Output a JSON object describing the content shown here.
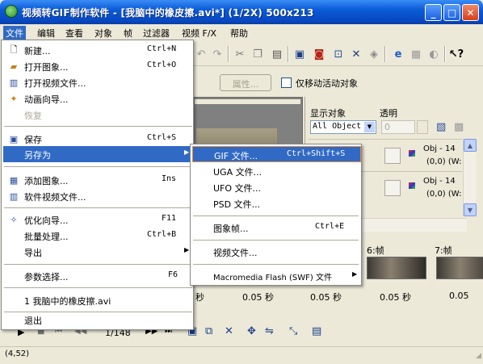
{
  "window": {
    "title": "视频转GIF制作软件  - [我脑中的橡皮擦.avi*] (1/2X)  500x213",
    "minimize": "_",
    "maximize": "□",
    "close": "✕"
  },
  "menubar": [
    "文件",
    "编辑",
    "查看",
    "对象",
    "帧",
    "过滤器",
    "视频 F/X",
    "帮助"
  ],
  "toolbar_icons": [
    "undo-icon",
    "redo-icon",
    "cut-icon",
    "copy-icon",
    "paste-icon",
    "crop-icon",
    "image-icon",
    "resize-icon",
    "crosshair-icon",
    "flip-icon",
    "ie-icon",
    "effects-icon",
    "hat-icon",
    "help-cursor-icon"
  ],
  "properties_button": "属性...",
  "move_active_only": "仅移动活动对象",
  "right_panel": {
    "display_objects_label": "显示对象",
    "transparency_label": "透明",
    "object_select_value": "All Object",
    "transparency_value": "0",
    "objects": [
      {
        "name": "Obj - 14",
        "pos": "(0,0) (W:"
      },
      {
        "name": "Obj - 14",
        "pos": "(0,0) (W:"
      }
    ]
  },
  "frames": {
    "labels": [
      "6:帧",
      "7:帧"
    ],
    "delays": [
      "秒",
      "0.05 秒",
      "0.05 秒",
      "0.05 秒",
      "0.05"
    ]
  },
  "playback": {
    "frame_counter": "1/148"
  },
  "status": {
    "coords": "(4,52)"
  },
  "file_menu": {
    "items": [
      {
        "label": "新建...",
        "shortcut": "Ctrl+N",
        "icon": "new-file-icon"
      },
      {
        "label": "打开图象...",
        "shortcut": "Ctrl+O",
        "icon": "open-image-icon"
      },
      {
        "label": "打开视频文件...",
        "shortcut": "",
        "icon": "open-video-icon"
      },
      {
        "label": "动画向导...",
        "shortcut": "",
        "icon": "wizard-icon"
      },
      {
        "label": "恢复",
        "shortcut": "",
        "icon": "",
        "disabled": true
      },
      {
        "label": "保存",
        "shortcut": "Ctrl+S",
        "icon": "save-icon"
      },
      {
        "label": "另存为",
        "shortcut": "",
        "icon": "",
        "submenu": true
      },
      {
        "label": "添加图象...",
        "shortcut": "Ins",
        "icon": "add-image-icon"
      },
      {
        "label": "软件视频文件...",
        "shortcut": "",
        "icon": "video-file-icon"
      },
      {
        "label": "优化向导...",
        "shortcut": "F11",
        "icon": "optimize-icon"
      },
      {
        "label": "批量处理...",
        "shortcut": "Ctrl+B",
        "icon": ""
      },
      {
        "label": "导出",
        "shortcut": "",
        "icon": "",
        "submenu": true
      },
      {
        "label": "参数选择...",
        "shortcut": "F6",
        "icon": ""
      },
      {
        "label": "1 我脑中的橡皮擦.avi",
        "shortcut": "",
        "icon": ""
      },
      {
        "label": "退出",
        "shortcut": "",
        "icon": ""
      }
    ]
  },
  "saveas_menu": {
    "items": [
      {
        "label": "GIF 文件...",
        "shortcut": "Ctrl+Shift+S"
      },
      {
        "label": "UGA 文件...",
        "shortcut": ""
      },
      {
        "label": "UFO 文件...",
        "shortcut": ""
      },
      {
        "label": "PSD 文件...",
        "shortcut": ""
      },
      {
        "label": "图象帧...",
        "shortcut": "Ctrl+E"
      },
      {
        "label": "视频文件...",
        "shortcut": ""
      },
      {
        "label": "Macromedia Flash (SWF) 文件",
        "shortcut": "",
        "submenu": true
      }
    ]
  },
  "colors": {
    "highlight": "#316ac5",
    "highlight_border": "#e08a3a",
    "titlebar": "#0a5bd8",
    "face": "#ece9d8"
  }
}
